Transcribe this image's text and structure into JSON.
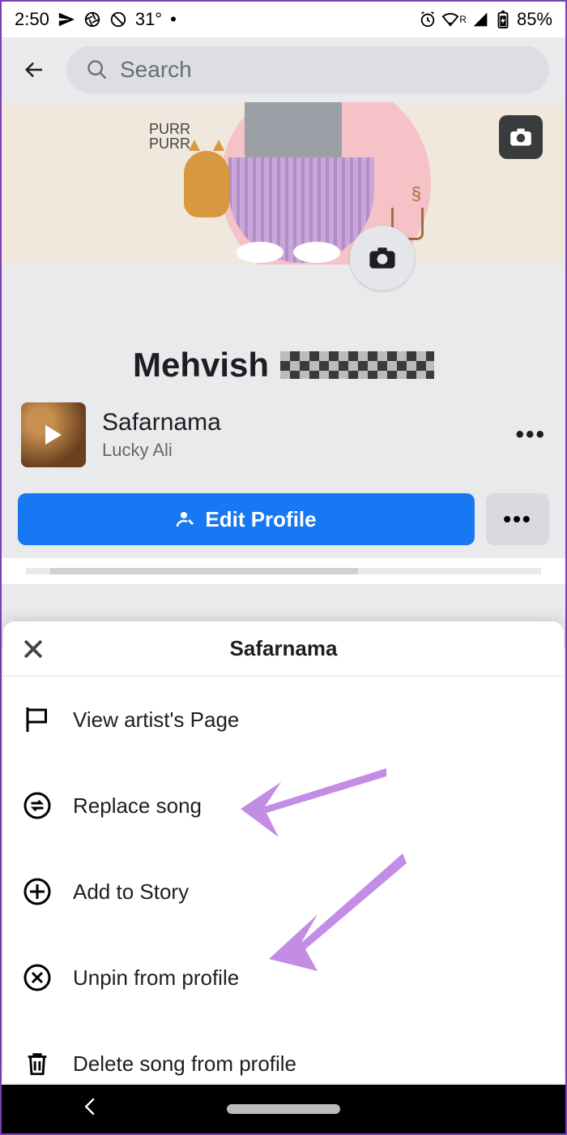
{
  "status": {
    "time": "2:50",
    "temp": "31°",
    "battery": "85%"
  },
  "search": {
    "placeholder": "Search"
  },
  "cover": {
    "purr": "PURR\nPURR"
  },
  "profile": {
    "name": "Mehvish"
  },
  "song": {
    "title": "Safarnama",
    "artist": "Lucky Ali"
  },
  "buttons": {
    "edit": "Edit Profile"
  },
  "sheet": {
    "title": "Safarnama",
    "items": [
      {
        "label": "View artist's Page"
      },
      {
        "label": "Replace song"
      },
      {
        "label": "Add to Story"
      },
      {
        "label": "Unpin from profile"
      },
      {
        "label": "Delete song from profile"
      }
    ]
  }
}
